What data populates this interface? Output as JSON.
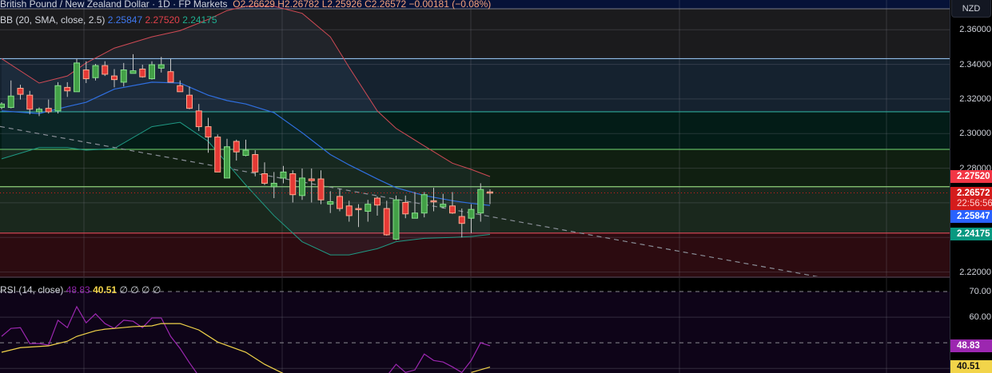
{
  "header": {
    "symbol": "British Pound / New Zealand Dollar · 1D · FP Markets",
    "open": "O2.26629",
    "high": "H2.26782",
    "low": "L2.25926",
    "close": "C2.26572",
    "change": "−0.00181 (−0.08%)"
  },
  "currency_button": "NZD",
  "bb_legend": {
    "label": "BB (20, SMA, close, 2.5)",
    "basis": "2.25847",
    "upper": "2.27520",
    "lower": "2.24175"
  },
  "rsi_legend": {
    "label": "RSI (14, close)",
    "rsi": "48.83",
    "ma": "40.51",
    "extra": [
      "∅",
      "∅",
      "∅",
      "∅"
    ]
  },
  "price_axis": {
    "ticks": [
      "2.36000",
      "2.34000",
      "2.32000",
      "2.30000",
      "2.28000",
      "2.22000"
    ],
    "tick_values": [
      2.36,
      2.34,
      2.32,
      2.3,
      2.28,
      2.22
    ],
    "badges": {
      "upper": "2.27520",
      "last": "2.26572",
      "countdown": "22:56:56",
      "basis": "2.25847",
      "lower": "2.24175"
    }
  },
  "rsi_axis": {
    "ticks": [
      "70.00",
      "60.00"
    ],
    "tick_values": [
      70,
      60
    ],
    "rsi_badge": "48.83",
    "ma_badge": "40.51"
  },
  "colors": {
    "up": "#43a047",
    "up_border": "#86e08a",
    "down": "#e53935",
    "down_border": "#ffab91",
    "wick": "#c8c8c8",
    "bb_upper": "#d04a55",
    "bb_basis": "#2f6fe0",
    "bb_lower": "#1f9a84",
    "rsi": "#9c27b0",
    "rsi_ma": "#f2d44a",
    "badge_upper": "#f23645",
    "badge_last": "#d41c1c",
    "badge_basis": "#2962ff",
    "badge_lower": "#089981"
  },
  "chart_data": [
    {
      "type": "candlestick",
      "title": "British Pound / New Zealand Dollar · 1D · FP Markets",
      "ylim": [
        2.2175,
        2.3772
      ],
      "grid": true,
      "candles_ohlc": [
        [
          2.3151,
          2.3181,
          2.3141,
          2.3171
        ],
        [
          2.3151,
          2.3307,
          2.3146,
          2.3217
        ],
        [
          2.3262,
          2.3282,
          2.3197,
          2.3227
        ],
        [
          2.3222,
          2.3247,
          2.3111,
          2.3141
        ],
        [
          2.3126,
          2.3151,
          2.3101,
          2.3141
        ],
        [
          2.3146,
          2.3197,
          2.3116,
          2.3126
        ],
        [
          2.3131,
          2.3297,
          2.3116,
          2.3277
        ],
        [
          2.3267,
          2.3297,
          2.3212,
          2.3247
        ],
        [
          2.3242,
          2.3433,
          2.3242,
          2.3408
        ],
        [
          2.3368,
          2.3418,
          2.3292,
          2.3317
        ],
        [
          2.3323,
          2.3403,
          2.3307,
          2.3393
        ],
        [
          2.3393,
          2.3418,
          2.3333,
          2.3343
        ],
        [
          2.3333,
          2.3373,
          2.3267,
          2.3312
        ],
        [
          2.3297,
          2.3408,
          2.3272,
          2.3368
        ],
        [
          2.3348,
          2.3459,
          2.3348,
          2.3363
        ],
        [
          2.3373,
          2.3398,
          2.3323,
          2.3328
        ],
        [
          2.3317,
          2.3418,
          2.3312,
          2.3398
        ],
        [
          2.3378,
          2.3443,
          2.3353,
          2.3398
        ],
        [
          2.3358,
          2.3433,
          2.3297,
          2.3297
        ],
        [
          2.3277,
          2.3307,
          2.3242,
          2.3242
        ],
        [
          2.3222,
          2.3272,
          2.3141,
          2.3146
        ],
        [
          2.3131,
          2.3171,
          2.3015,
          2.304
        ],
        [
          2.304,
          2.3091,
          2.2889,
          2.298
        ],
        [
          2.298,
          2.2995,
          2.2778,
          2.2778
        ],
        [
          2.2743,
          2.297,
          2.2743,
          2.2924
        ],
        [
          2.2955,
          2.2965,
          2.2844,
          2.2894
        ],
        [
          2.2874,
          2.2965,
          2.2869,
          2.2904
        ],
        [
          2.2879,
          2.2904,
          2.2753,
          2.2778
        ],
        [
          2.2768,
          2.2834,
          2.2703,
          2.2713
        ],
        [
          2.2693,
          2.2778,
          2.2627,
          2.2713
        ],
        [
          2.2743,
          2.2813,
          2.2713,
          2.2778
        ],
        [
          2.2768,
          2.2788,
          2.2602,
          2.2647
        ],
        [
          2.2642,
          2.2798,
          2.2617,
          2.2743
        ],
        [
          2.2738,
          2.2798,
          2.2602,
          2.2728
        ],
        [
          2.2738,
          2.2788,
          2.2592,
          2.2617
        ],
        [
          2.2592,
          2.2667,
          2.2541,
          2.2607
        ],
        [
          2.2637,
          2.2682,
          2.2551,
          2.2567
        ],
        [
          2.2582,
          2.2612,
          2.2491,
          2.2526
        ],
        [
          2.2567,
          2.2592,
          2.246,
          2.2562
        ],
        [
          2.2551,
          2.2617,
          2.2491,
          2.2592
        ],
        [
          2.2627,
          2.2637,
          2.2526,
          2.2587
        ],
        [
          2.2567,
          2.2612,
          2.241,
          2.2415
        ],
        [
          2.239,
          2.2642,
          2.2385,
          2.2617
        ],
        [
          2.2602,
          2.2642,
          2.2511,
          2.2536
        ],
        [
          2.2511,
          2.2662,
          2.2511,
          2.2541
        ],
        [
          2.2541,
          2.2662,
          2.2516,
          2.2647
        ],
        [
          2.2612,
          2.2687,
          2.2551,
          2.2607
        ],
        [
          2.2577,
          2.2652,
          2.2567,
          2.2592
        ],
        [
          2.2582,
          2.2662,
          2.2536,
          2.2541
        ],
        [
          2.2521,
          2.2567,
          2.24,
          2.2481
        ],
        [
          2.2511,
          2.2592,
          2.2425,
          2.2562
        ],
        [
          2.2541,
          2.2713,
          2.2491,
          2.2677
        ],
        [
          2.26629,
          2.26782,
          2.25926,
          2.26572
        ]
      ],
      "bollinger": {
        "bars": [
          1,
          5,
          8,
          10,
          13,
          17,
          20,
          23,
          25,
          27,
          30,
          33,
          36,
          38,
          41,
          43,
          46,
          49,
          51,
          53
        ],
        "upper": [
          2.3433,
          2.3292,
          2.3333,
          2.3408,
          2.3494,
          2.3559,
          2.3595,
          2.366,
          2.3711,
          2.3736,
          2.3736,
          2.3695,
          2.3559,
          2.3383,
          2.3131,
          2.303,
          2.2929,
          2.2829,
          2.2793,
          2.2752
        ],
        "basis": [
          2.3131,
          2.3116,
          2.3156,
          2.3181,
          2.3257,
          2.3297,
          2.3292,
          2.3222,
          2.3191,
          2.3171,
          2.3121,
          2.3005,
          2.2879,
          2.2819,
          2.2738,
          2.2687,
          2.2642,
          2.2612,
          2.2597,
          2.25847
        ],
        "lower": [
          2.2854,
          2.2919,
          2.2919,
          2.2904,
          2.2914,
          2.304,
          2.3065,
          2.2955,
          2.2829,
          2.2703,
          2.2526,
          2.2375,
          2.2299,
          2.2299,
          2.2335,
          2.2375,
          2.2395,
          2.24,
          2.2405,
          2.24175
        ]
      },
      "horizontal_levels": [
        {
          "price": 2.3433,
          "color": "#8fbbe6"
        },
        {
          "price": 2.3126,
          "color": "#2fa89a"
        },
        {
          "price": 2.2909,
          "color": "#5fb65f"
        },
        {
          "price": 2.2693,
          "color": "#8fd07a"
        },
        {
          "price": 2.2425,
          "color": "#e04858"
        }
      ],
      "zones": [
        {
          "from": 2.3433,
          "to": 2.4,
          "color": "#1b1b1d"
        },
        {
          "from": 2.3126,
          "to": 2.3433,
          "color": "#15222f"
        },
        {
          "from": 2.2909,
          "to": 2.3126,
          "color": "#031c17"
        },
        {
          "from": 2.2693,
          "to": 2.2909,
          "color": "#101f11"
        },
        {
          "from": 2.2425,
          "to": 2.2693,
          "color": "#1a281d"
        },
        {
          "from": 2.2,
          "to": 2.2425,
          "color": "#2c0b10"
        }
      ],
      "trend_line": [
        [
          0.83,
          2.3041
        ],
        [
          90.2,
          2.215
        ]
      ],
      "last_price": 2.26572
    },
    {
      "type": "line",
      "title": "RSI (14, close)",
      "ylim": [
        38.2,
        75.3
      ],
      "levels": [
        70,
        60,
        50
      ],
      "rsi": [
        52.5,
        55.6,
        55.9,
        49.7,
        49.7,
        49.1,
        58.8,
        55.9,
        64.1,
        57.8,
        61.3,
        57.5,
        55.6,
        58.8,
        58.4,
        55.9,
        59.7,
        59.7,
        52.5,
        47.8,
        42.2,
        37.0,
        null,
        null,
        null,
        null,
        null,
        null,
        null,
        null,
        null,
        null,
        null,
        null,
        null,
        null,
        null,
        null,
        null,
        null,
        null,
        37.0,
        41.6,
        38.4,
        39.4,
        45.6,
        43.1,
        42.5,
        40.6,
        38.4,
        43.1,
        50.0,
        48.83
      ],
      "rsi_ma_segments": [
        [
          [
            1,
            46.3
          ],
          [
            3,
            48.1
          ],
          [
            6,
            48.8
          ],
          [
            8,
            50.6
          ],
          [
            9,
            52.5
          ],
          [
            11,
            54.7
          ],
          [
            12,
            55.3
          ],
          [
            13,
            55.6
          ],
          [
            15,
            56.3
          ],
          [
            17,
            56.6
          ],
          [
            18,
            57.5
          ],
          [
            20,
            57.5
          ],
          [
            22,
            55.0
          ],
          [
            24,
            50.3
          ],
          [
            27,
            46.3
          ],
          [
            29,
            41.6
          ],
          [
            31,
            38.0
          ]
        ],
        [
          [
            51,
            38.4
          ],
          [
            53,
            40.51
          ]
        ]
      ]
    }
  ]
}
